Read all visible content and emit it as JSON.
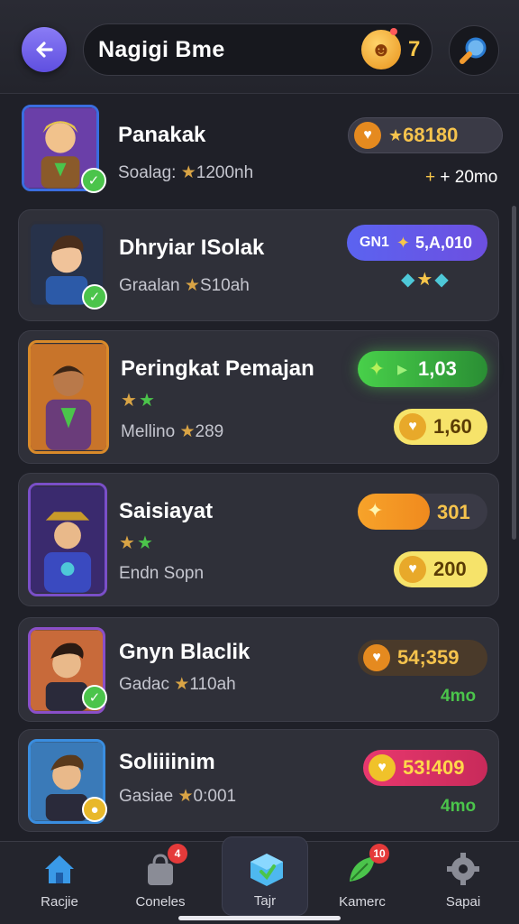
{
  "header": {
    "title": "Nagigi Bme",
    "coin_count": "7",
    "back_icon": "arrow-left-icon",
    "search_icon": "search-icon"
  },
  "players": [
    {
      "name": "Panakak",
      "sub_label": "Soalag:",
      "sub_value": "1200nh",
      "badge_text": "68180",
      "extra": "+ 20mo",
      "pill_style": "dark-gold"
    },
    {
      "name": "Dhryiar ISolak",
      "sub_label": "Graalan",
      "sub_value": "S10ah",
      "badge_text": "5,A,010",
      "badge_prefix": "GN1",
      "pill_style": "blue"
    },
    {
      "name": "Peringkat Pemajan",
      "sub_label": "Mellino",
      "sub_value": "289",
      "badge_text": "1,03",
      "badge2": "1,60",
      "pill_style": "green"
    },
    {
      "name": "Saisiayat",
      "sub_label": "Endn Sopn",
      "sub_value": "",
      "badge_text": "301",
      "badge2": "200",
      "pill_style": "orange"
    },
    {
      "name": "Gnyn Blaclik",
      "sub_label": "Gadac",
      "sub_value": "110ah",
      "badge_text": "54;359",
      "extra": "4mo",
      "pill_style": "dark-gold"
    },
    {
      "name": "Soliiiinim",
      "sub_label": "Gasiae",
      "sub_value": "0:001",
      "badge_text": "53!409",
      "extra": "4mo",
      "pill_style": "pink"
    }
  ],
  "nav": [
    {
      "label": "Racjie",
      "icon": "home-icon"
    },
    {
      "label": "Coneles",
      "icon": "bag-icon",
      "badge": "4"
    },
    {
      "label": "Tajr",
      "icon": "cube-icon"
    },
    {
      "label": "Kamerc",
      "icon": "leaf-icon",
      "badge": "10"
    },
    {
      "label": "Sapai",
      "icon": "gear-icon"
    }
  ],
  "colors": {
    "accent": "#6a5ae8",
    "gold": "#f7c64a",
    "green": "#4bc44b",
    "bg": "#1f2028"
  }
}
